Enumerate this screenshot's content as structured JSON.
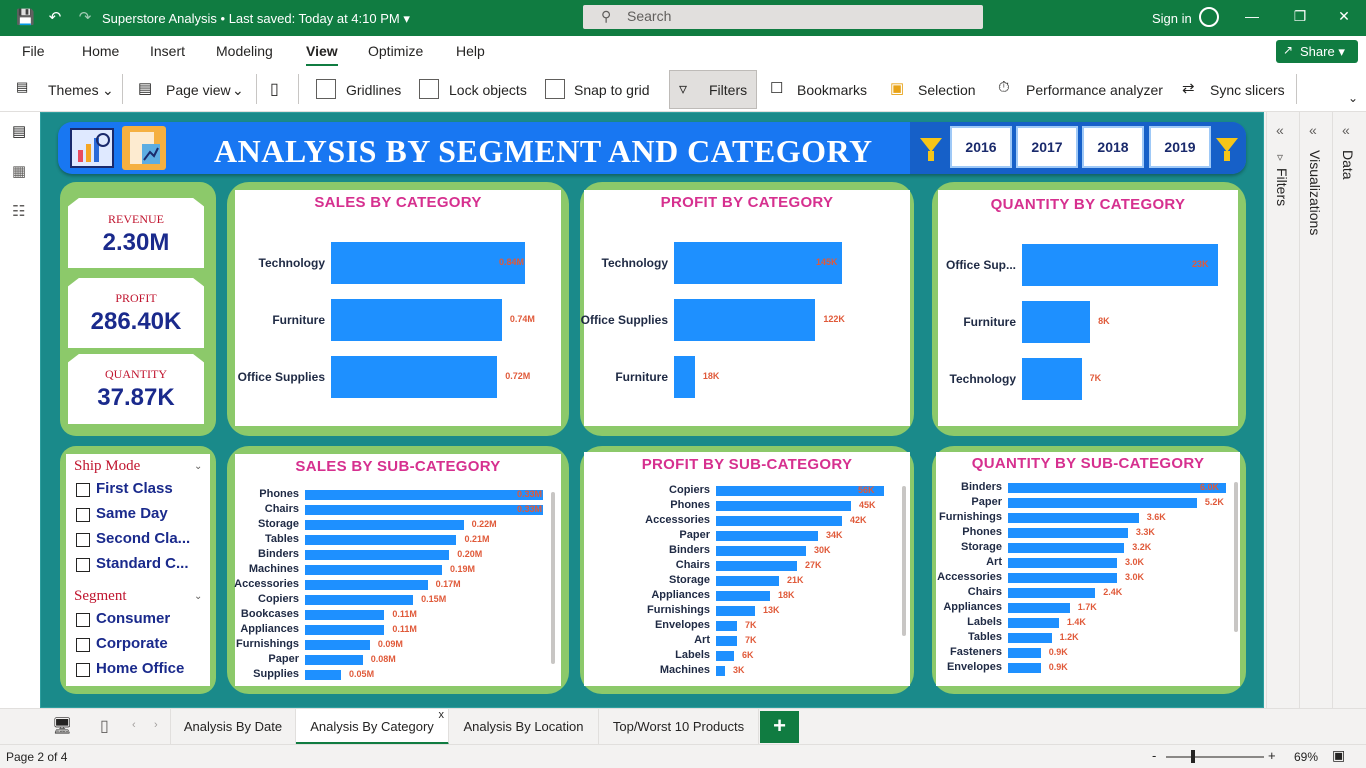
{
  "titlebar": {
    "title": "Superstore Analysis",
    "saved": "• Last saved: Today at 4:10 PM",
    "search_placeholder": "Search",
    "signin": "Sign in"
  },
  "menu": [
    "File",
    "Home",
    "Insert",
    "Modeling",
    "View",
    "Optimize",
    "Help"
  ],
  "share_label": "Share",
  "ribbon": {
    "themes": "Themes",
    "page_view": "Page view",
    "gridlines": "Gridlines",
    "lock_objects": "Lock objects",
    "snap_to_grid": "Snap to grid",
    "filters": "Filters",
    "bookmarks": "Bookmarks",
    "selection": "Selection",
    "performance": "Performance analyzer",
    "sync_slicers": "Sync slicers"
  },
  "report": {
    "title": "ANALYSIS BY SEGMENT AND CATEGORY",
    "years": [
      "2016",
      "2017",
      "2018",
      "2019"
    ],
    "kpis": [
      {
        "label": "REVENUE",
        "value": "2.30M"
      },
      {
        "label": "PROFIT",
        "value": "286.40K"
      },
      {
        "label": "QUANTITY",
        "value": "37.87K"
      }
    ],
    "ship_mode": {
      "title": "Ship Mode",
      "items": [
        "First Class",
        "Same Day",
        "Second Cla...",
        "Standard C..."
      ]
    },
    "segment": {
      "title": "Segment",
      "items": [
        "Consumer",
        "Corporate",
        "Home Office"
      ]
    }
  },
  "chart_data": [
    {
      "type": "bar",
      "title": "SALES BY CATEGORY",
      "categories": [
        "Technology",
        "Furniture",
        "Office Supplies"
      ],
      "values": [
        0.84,
        0.74,
        0.72
      ],
      "labels": [
        "0.84M",
        "0.74M",
        "0.72M"
      ],
      "max": 0.84
    },
    {
      "type": "bar",
      "title": "PROFIT BY CATEGORY",
      "categories": [
        "Technology",
        "Office Supplies",
        "Furniture"
      ],
      "values": [
        145,
        122,
        18
      ],
      "labels": [
        "145K",
        "122K",
        "18K"
      ],
      "max": 145
    },
    {
      "type": "bar",
      "title": "QUANTITY BY CATEGORY",
      "categories": [
        "Office Sup...",
        "Furniture",
        "Technology"
      ],
      "values": [
        23,
        8,
        7
      ],
      "labels": [
        "23K",
        "8K",
        "7K"
      ],
      "max": 23
    },
    {
      "type": "bar",
      "title": "SALES BY SUB-CATEGORY",
      "categories": [
        "Phones",
        "Chairs",
        "Storage",
        "Tables",
        "Binders",
        "Machines",
        "Accessories",
        "Copiers",
        "Bookcases",
        "Appliances",
        "Furnishings",
        "Paper",
        "Supplies"
      ],
      "values": [
        0.33,
        0.33,
        0.22,
        0.21,
        0.2,
        0.19,
        0.17,
        0.15,
        0.11,
        0.11,
        0.09,
        0.08,
        0.05
      ],
      "labels": [
        "0.33M",
        "0.33M",
        "0.22M",
        "0.21M",
        "0.20M",
        "0.19M",
        "0.17M",
        "0.15M",
        "0.11M",
        "0.11M",
        "0.09M",
        "0.08M",
        "0.05M"
      ],
      "max": 0.33
    },
    {
      "type": "bar",
      "title": "PROFIT BY SUB-CATEGORY",
      "categories": [
        "Copiers",
        "Phones",
        "Accessories",
        "Paper",
        "Binders",
        "Chairs",
        "Storage",
        "Appliances",
        "Furnishings",
        "Envelopes",
        "Art",
        "Labels",
        "Machines"
      ],
      "values": [
        56,
        45,
        42,
        34,
        30,
        27,
        21,
        18,
        13,
        7,
        7,
        6,
        3
      ],
      "labels": [
        "56K",
        "45K",
        "42K",
        "34K",
        "30K",
        "27K",
        "21K",
        "18K",
        "13K",
        "7K",
        "7K",
        "6K",
        "3K"
      ],
      "max": 56
    },
    {
      "type": "bar",
      "title": "QUANTITY BY SUB-CATEGORY",
      "categories": [
        "Binders",
        "Paper",
        "Furnishings",
        "Phones",
        "Storage",
        "Art",
        "Accessories",
        "Chairs",
        "Appliances",
        "Labels",
        "Tables",
        "Fasteners",
        "Envelopes"
      ],
      "values": [
        6.0,
        5.2,
        3.6,
        3.3,
        3.2,
        3.0,
        3.0,
        2.4,
        1.7,
        1.4,
        1.2,
        0.9,
        0.9
      ],
      "labels": [
        "6.0K",
        "5.2K",
        "3.6K",
        "3.3K",
        "3.2K",
        "3.0K",
        "3.0K",
        "2.4K",
        "1.7K",
        "1.4K",
        "1.2K",
        "0.9K",
        "0.9K"
      ],
      "max": 6.0
    }
  ],
  "panes": {
    "filters": "Filters",
    "visualizations": "Visualizations",
    "data": "Data"
  },
  "tabs": [
    "Analysis By Date",
    "Analysis By Category",
    "Analysis By Location",
    "Top/Worst 10 Products"
  ],
  "status": {
    "page": "Page 2 of 4",
    "zoom": "69%"
  },
  "colors": {
    "brand": "#107c41",
    "canvas": "#1a8a8a",
    "bar": "#1e90ff",
    "title": "#d6308f"
  }
}
